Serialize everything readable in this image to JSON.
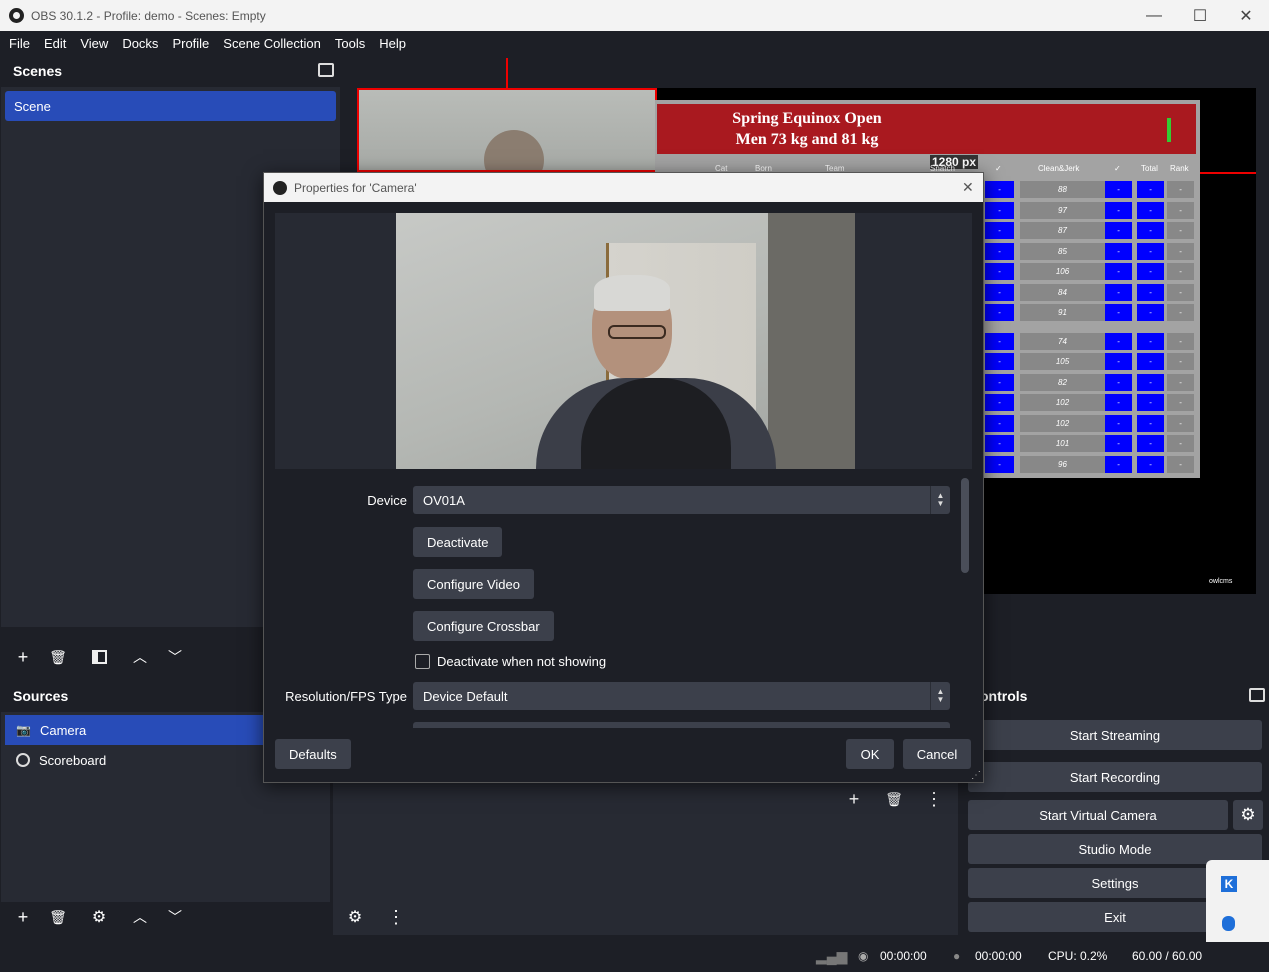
{
  "window": {
    "title": "OBS 30.1.2 - Profile: demo - Scenes: Empty",
    "minimize": "—",
    "maximize": "☐",
    "close": "✕"
  },
  "menu": [
    "File",
    "Edit",
    "View",
    "Docks",
    "Profile",
    "Scene Collection",
    "Tools",
    "Help"
  ],
  "scenes": {
    "header": "Scenes",
    "items": [
      "Scene"
    ]
  },
  "sources": {
    "header": "Sources",
    "items": [
      {
        "label": "Camera",
        "icon": "camera-icon"
      },
      {
        "label": "Scoreboard",
        "icon": "globe-icon"
      }
    ]
  },
  "controls": {
    "header": "ontrols",
    "start_streaming": "Start Streaming",
    "start_recording": "Start Recording",
    "start_virtual_camera": "Start Virtual Camera",
    "studio_mode": "Studio Mode",
    "settings": "Settings",
    "exit": "Exit"
  },
  "preview": {
    "scoreboard_title_1": "Spring Equinox Open",
    "scoreboard_title_2": "Men 73 kg and 81 kg",
    "size_tooltip": "1280 px",
    "headers": [
      "Cat",
      "Born",
      "Team",
      "Snatch",
      "✓",
      "Clean&Jerk",
      "✓",
      "Total",
      "Rank"
    ],
    "cj_values": [
      "88",
      "97",
      "87",
      "85",
      "106",
      "84",
      "91",
      "74",
      "105",
      "82",
      "102",
      "102",
      "101",
      "96"
    ],
    "cell_dash": "-",
    "brand": "owlcms"
  },
  "dialog": {
    "title": "Properties for 'Camera'",
    "close": "✕",
    "device_label": "Device",
    "device_value": "OV01A",
    "deactivate": "Deactivate",
    "configure_video": "Configure Video",
    "configure_crossbar": "Configure Crossbar",
    "deactivate_when_not_showing": "Deactivate when not showing",
    "resolution_label": "Resolution/FPS Type",
    "resolution_value": "Device Default",
    "defaults": "Defaults",
    "ok": "OK",
    "cancel": "Cancel"
  },
  "status": {
    "rec_time_1": "00:00:00",
    "rec_time_2": "00:00:00",
    "cpu": "CPU: 0.2%",
    "fps": "60.00 / 60.00"
  },
  "colors": {
    "accent": "#284cb8",
    "bg": "#1d1f26",
    "panel": "#272a33",
    "button": "#3c404b",
    "scoreboard_red": "#a9191f",
    "cell_blue": "#0000ff"
  }
}
